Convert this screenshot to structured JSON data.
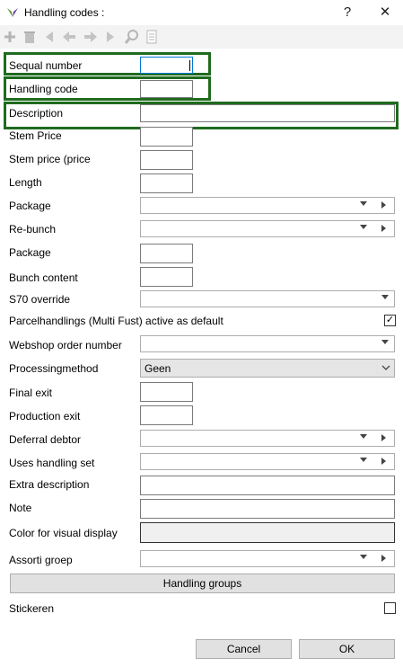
{
  "window": {
    "title": "Handling codes :",
    "help_label": "?",
    "close_label": "✕"
  },
  "toolbar": {
    "icons": [
      "add-icon",
      "delete-icon",
      "first-icon",
      "previous-icon",
      "next-icon",
      "last-icon",
      "search-icon",
      "document-icon"
    ]
  },
  "fields": {
    "sequal_number": "Sequal number",
    "handling_code": "Handling code",
    "description": "Description",
    "stem_price": "Stem Price",
    "stem_price_price": "Stem price (price",
    "length": "Length",
    "package": "Package",
    "re_bunch": "Re-bunch",
    "package2": "Package",
    "bunch_content": "Bunch content",
    "s70_override": "S70 override",
    "parcelhandlings": "Parcelhandlings (Multi Fust) active as default",
    "webshop_order_number": "Webshop order number",
    "processingmethod": "Processingmethod",
    "processingmethod_value": "Geen",
    "final_exit": "Final exit",
    "production_exit": "Production exit",
    "deferral_debtor": "Deferral debtor",
    "uses_handling_set": "Uses handling set",
    "extra_description": "Extra description",
    "note": "Note",
    "color_visual": "Color for visual display",
    "assorti_groep": "Assorti groep",
    "stickeren": "Stickeren"
  },
  "checks": {
    "parcelhandlings_checked": "✓",
    "stickeren_checked": ""
  },
  "buttons": {
    "handling_groups": "Handling groups",
    "cancel": "Cancel",
    "ok": "OK"
  },
  "colors": {
    "highlight": "#1f6b1f",
    "logo": "#6b3fa0"
  }
}
